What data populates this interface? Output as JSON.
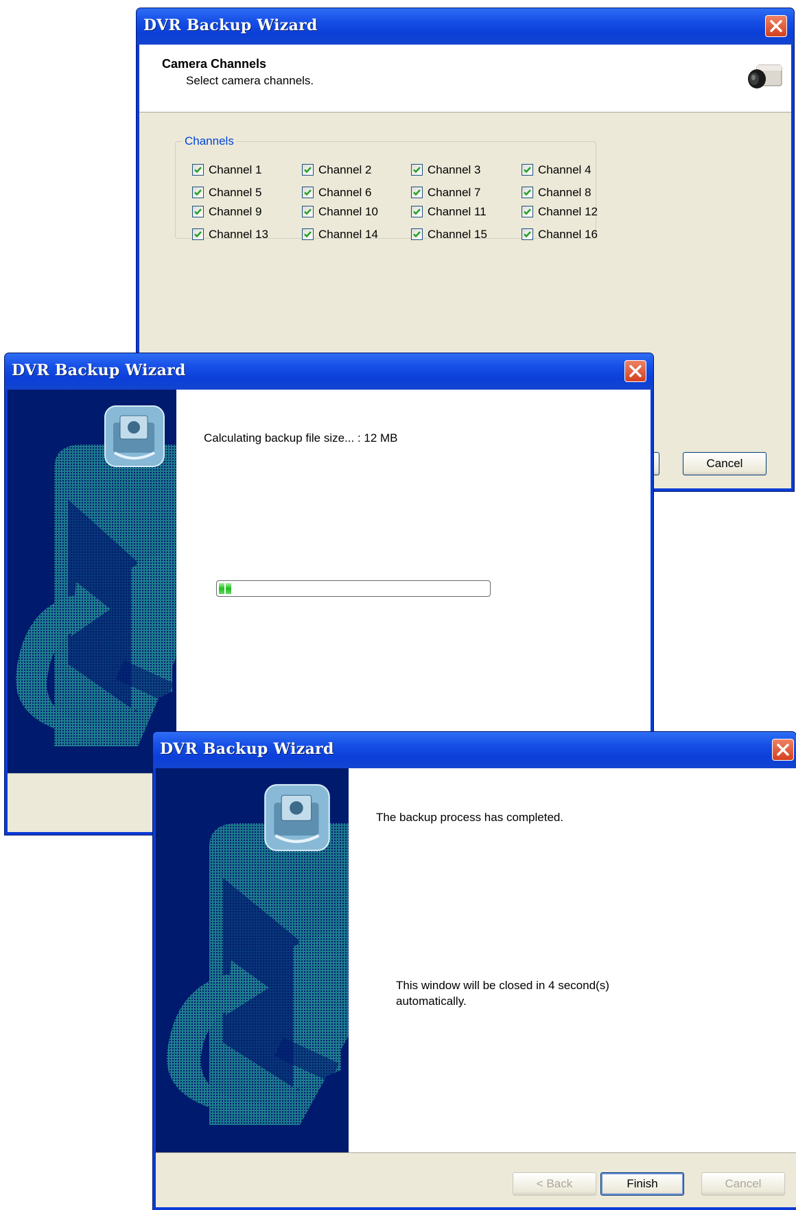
{
  "windows": {
    "channels": {
      "title": "DVR Backup Wizard",
      "header_title": "Camera Channels",
      "header_subtitle": "Select camera channels.",
      "group_label": "Channels",
      "channels": [
        {
          "label": "Channel 1",
          "checked": true
        },
        {
          "label": "Channel 2",
          "checked": true
        },
        {
          "label": "Channel 3",
          "checked": true
        },
        {
          "label": "Channel 4",
          "checked": true
        },
        {
          "label": "Channel 5",
          "checked": true
        },
        {
          "label": "Channel 6",
          "checked": true
        },
        {
          "label": "Channel 7",
          "checked": true
        },
        {
          "label": "Channel 8",
          "checked": true
        },
        {
          "label": "Channel 9",
          "checked": true
        },
        {
          "label": "Channel 10",
          "checked": true
        },
        {
          "label": "Channel 11",
          "checked": true
        },
        {
          "label": "Channel 12",
          "checked": true
        },
        {
          "label": "Channel 13",
          "checked": true
        },
        {
          "label": "Channel 14",
          "checked": true
        },
        {
          "label": "Channel 15",
          "checked": true
        },
        {
          "label": "Channel 16",
          "checked": true
        }
      ],
      "cancel_label": "Cancel"
    },
    "calculating": {
      "title": "DVR Backup Wizard",
      "status_text": "Calculating backup file size... : 12 MB",
      "progress_fraction": 0.05
    },
    "completed": {
      "title": "DVR Backup Wizard",
      "message": "The backup process has completed.",
      "countdown_line1": "This window will be closed in 4 second(s)",
      "countdown_line2": "automatically.",
      "back_label": "< Back",
      "finish_label": "Finish",
      "cancel_label": "Cancel"
    }
  },
  "icons": {
    "close": "close-icon",
    "camera": "camera-icon",
    "backup_badge": "backup-device-icon",
    "checkbox": "checkmark-icon"
  },
  "colors": {
    "titlebar": "#0b3fd8",
    "close": "#d3411f",
    "side_panel": "#001a6e",
    "art": "#1f7e8f",
    "progress": "#1fbe1f"
  }
}
